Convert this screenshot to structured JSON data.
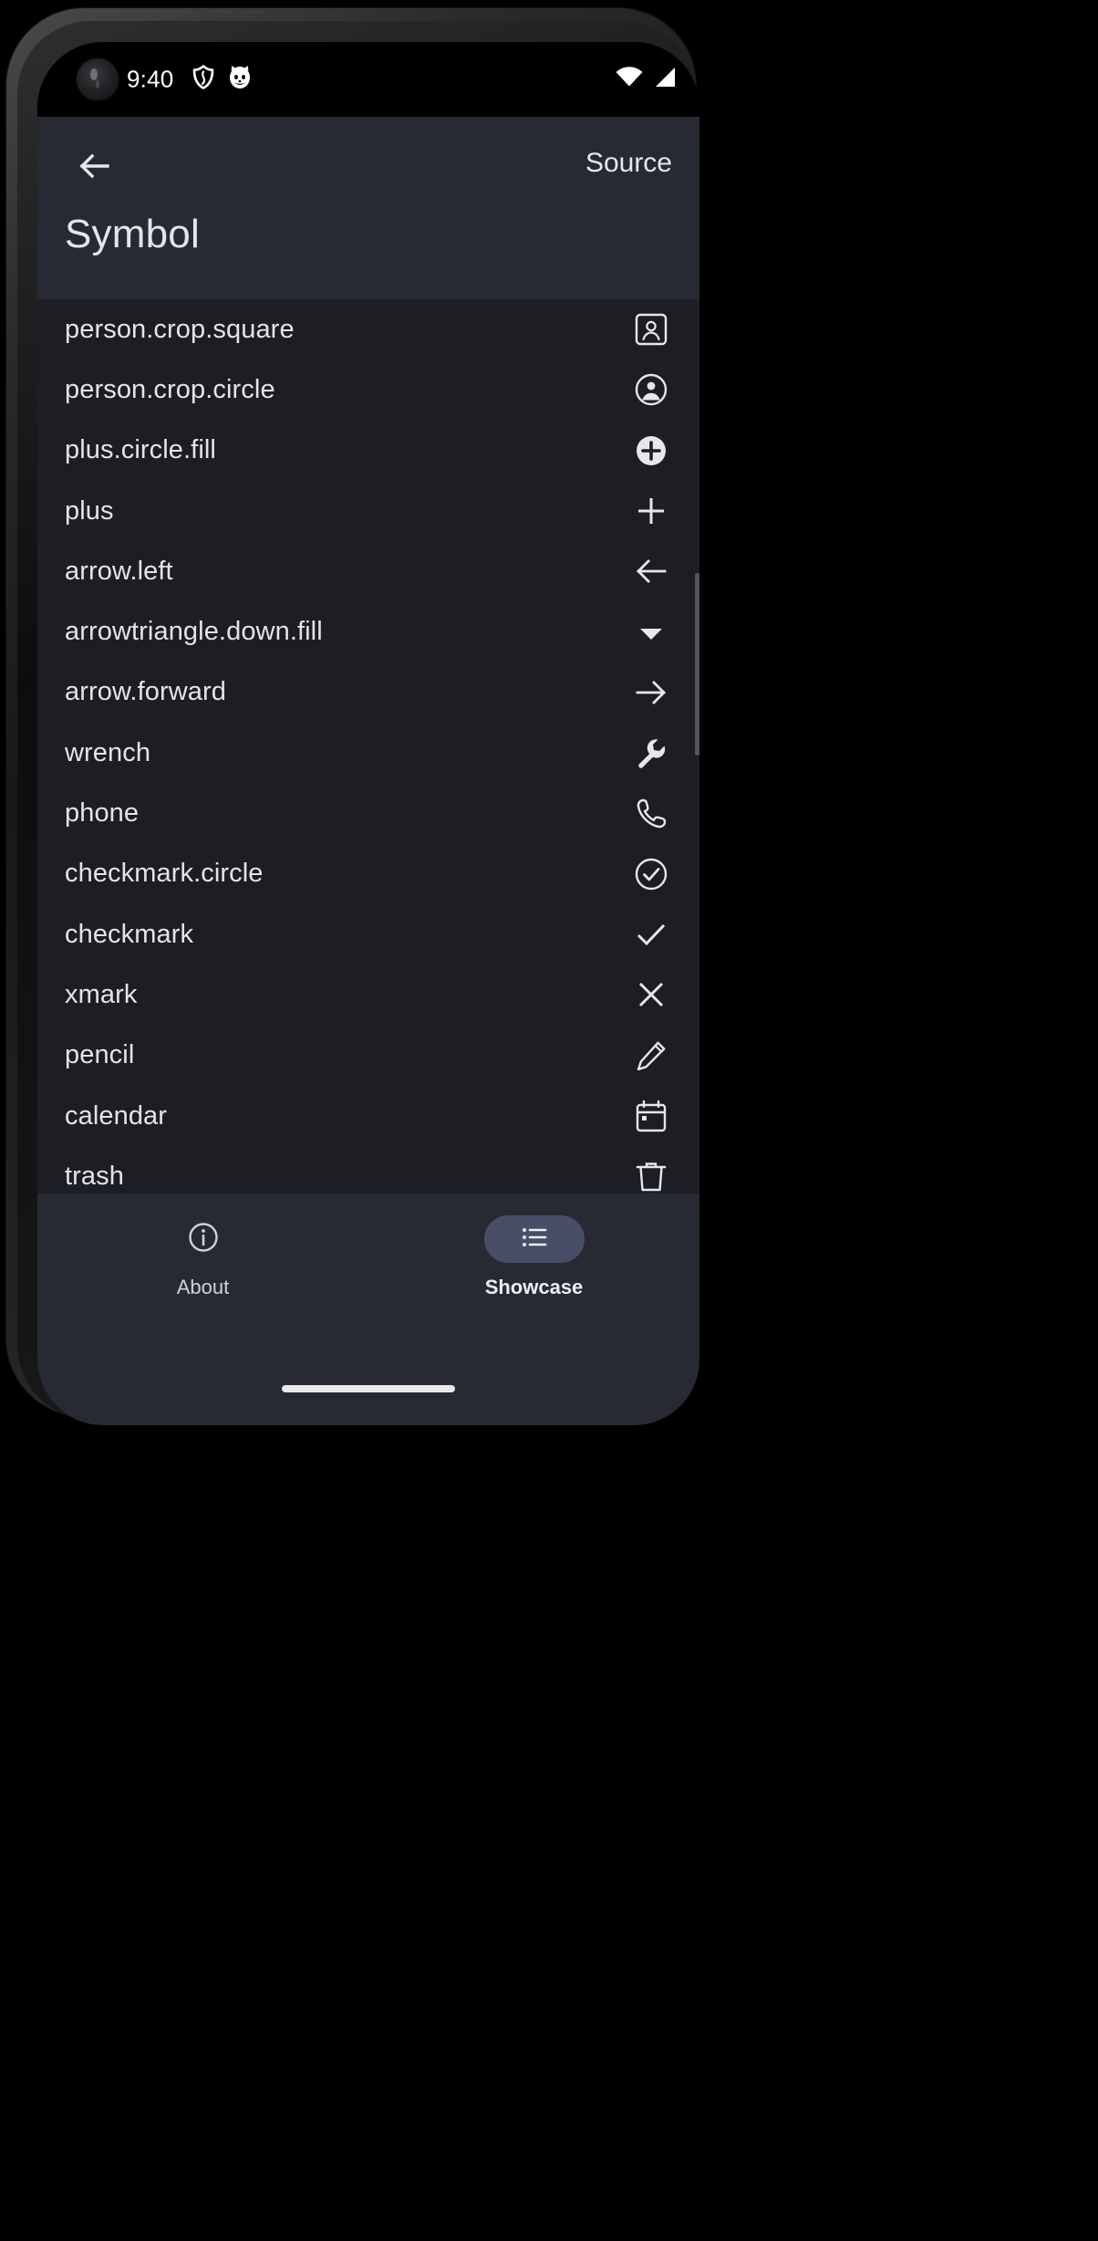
{
  "status_bar": {
    "time": "9:40",
    "icons": [
      "shield-icon",
      "cat-icon"
    ],
    "right_icons": [
      "wifi-icon",
      "cell-signal-icon"
    ]
  },
  "app_bar": {
    "back_icon": "arrow-left-icon",
    "source_label": "Source",
    "title": "Symbol"
  },
  "list": {
    "rows": [
      {
        "label": "person.crop.square",
        "icon": "person-crop-square-icon"
      },
      {
        "label": "person.crop.circle",
        "icon": "person-crop-circle-icon"
      },
      {
        "label": "plus.circle.fill",
        "icon": "plus-circle-fill-icon"
      },
      {
        "label": "plus",
        "icon": "plus-icon"
      },
      {
        "label": "arrow.left",
        "icon": "arrow-left-icon"
      },
      {
        "label": "arrowtriangle.down.fill",
        "icon": "arrowtriangle-down-fill-icon"
      },
      {
        "label": "arrow.forward",
        "icon": "arrow-forward-icon"
      },
      {
        "label": "wrench",
        "icon": "wrench-icon"
      },
      {
        "label": "phone",
        "icon": "phone-icon"
      },
      {
        "label": "checkmark.circle",
        "icon": "checkmark-circle-icon"
      },
      {
        "label": "checkmark",
        "icon": "checkmark-icon"
      },
      {
        "label": "xmark",
        "icon": "xmark-icon"
      },
      {
        "label": "pencil",
        "icon": "pencil-icon"
      },
      {
        "label": "calendar",
        "icon": "calendar-icon"
      },
      {
        "label": "trash",
        "icon": "trash-icon"
      }
    ]
  },
  "bottom_nav": {
    "items": [
      {
        "label": "About",
        "icon": "info-circle-icon",
        "active": false
      },
      {
        "label": "Showcase",
        "icon": "list-icon",
        "active": true
      }
    ]
  },
  "colors": {
    "app_bar_bg": "#272a33",
    "list_bg": "#1c1e24",
    "text_primary": "#e3e4e9",
    "active_pill": "#474e66"
  }
}
